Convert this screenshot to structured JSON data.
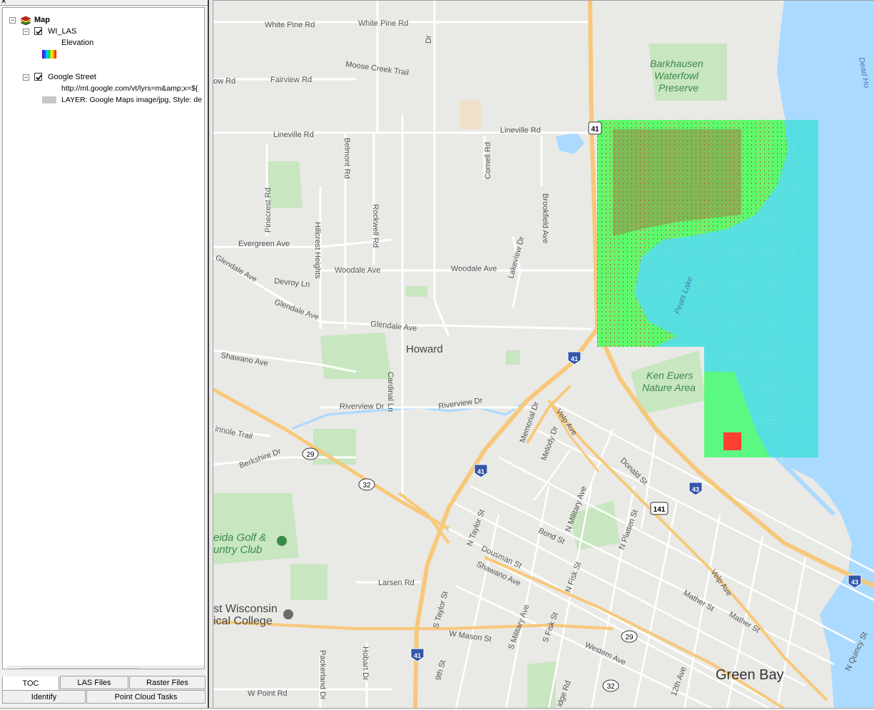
{
  "toc": {
    "root_label": "Map",
    "layers": [
      {
        "label": "WI_LAS",
        "checked": true,
        "sublabel": "Elevation"
      },
      {
        "label": "Google Street",
        "checked": true,
        "url": "http://mt.google.com/vt/lyrs=m&amp;x=${",
        "desc": "LAYER: Google Maps image/jpg, Style: de"
      }
    ]
  },
  "tabs": {
    "row1": [
      "TOC",
      "LAS Files",
      "Raster Files"
    ],
    "row2": [
      "Identify",
      "Point Cloud Tasks"
    ]
  },
  "map": {
    "labels": {
      "white_pine_1": "White Pine Rd",
      "white_pine_2": "White Pine Rd",
      "fairview": "Fairview Rd",
      "moose_creek": "Moose Creek Trail",
      "lineville_1": "Lineville Rd",
      "lineville_2": "Lineville Rd",
      "evergreen": "Evergreen Ave",
      "woodale_1": "Woodale Ave",
      "woodale_2": "Woodale Ave",
      "devroy": "Devroy Ln",
      "glendale_1": "Glendale Ave",
      "glendale_2": "Glendale Ave",
      "glendale_3": "Glendale Ave",
      "shawano_1": "Shawano Ave",
      "shawano_2": "Shawano Ave",
      "riverview_1": "Riverview Dr",
      "riverview_2": "Riverview Dr",
      "larsen": "Larsen Rd",
      "w_mason": "W Mason St",
      "w_point": "W Point Rd",
      "howard": "Howard",
      "green_bay": "Green Bay",
      "barkhausen_1": "Barkhausen",
      "barkhausen_2": "Waterfowl",
      "barkhausen_3": "Preserve",
      "ken_euers_1": "Ken Euers",
      "ken_euers_2": "Nature Area",
      "peats_lake": "Peats Lake",
      "oneida_1": "eida Golf &",
      "oneida_2": "untry Club",
      "nwtc_1": "st Wisconsin",
      "nwtc_2": "ical College",
      "velp_ave": "Velp Ave",
      "cardinal_ln": "Cardinal Ln",
      "bond_st": "Bond St",
      "dousman_st": "Dousman St",
      "mather_st": "Mather St",
      "western_ave": "Western Ave",
      "n_taylor": "N Taylor St",
      "s_taylor": "S Taylor St",
      "n_military": "N Military Ave",
      "s_military": "S Military Ave",
      "n_platten": "N Platten St",
      "n_fisk": "N Fisk St",
      "s_fisk": "S Fisk St",
      "memorial": "Memorial Dr",
      "melody": "Melody Dr",
      "donald": "Donald St",
      "n_quincy": "N Quincy St",
      "belmont": "Belmont Rd",
      "rockwell": "Rockwell Rd",
      "pinecrest": "Pinecrest Rd",
      "hillcrest": "Hillcrest Heights",
      "lakeview": "Lakeview Dr",
      "cornell": "Cornell Rd",
      "brookfield": "Brookfield Ave",
      "packerland": "Packerland Dr",
      "hobart": "Hobart Dr",
      "berkshire": "Berkshire Dr",
      "chinnole": "innole Trail",
      "dead_horse": "Dead Ho",
      "ninth_st": "9th St",
      "twelfth": "12th Ave",
      "ridge": "idge Rd",
      "velp_mather": "Velp Ave",
      "mather_st2": "Mather St",
      "ow_rd": "ow Rd",
      "oak_dr": "Dr"
    },
    "shields": {
      "us41_top": "41",
      "i41_a": "41",
      "i41_b": "41",
      "i41_c": "41",
      "i43_a": "43",
      "i43_b": "43",
      "us141": "141",
      "wi29_a": "29",
      "wi29_b": "29",
      "wi32_a": "32",
      "wi32_b": "32"
    }
  }
}
